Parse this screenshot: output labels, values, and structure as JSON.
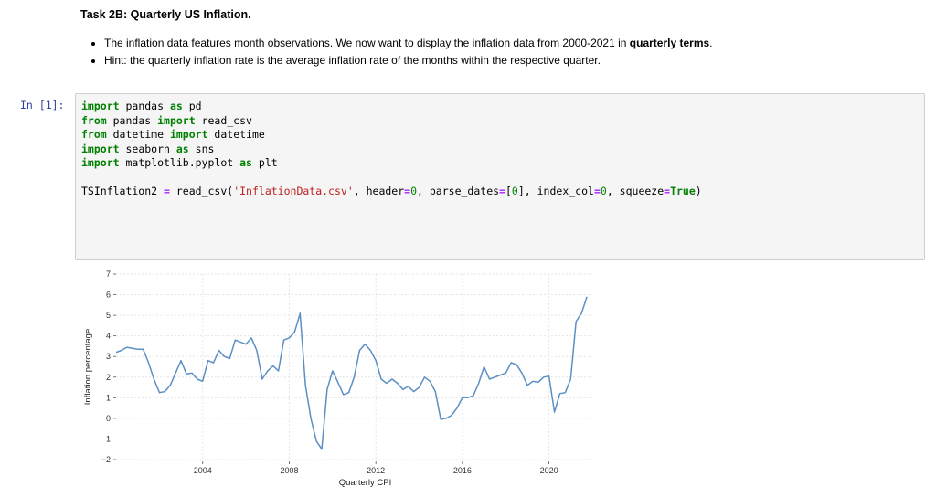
{
  "markdown": {
    "heading": "Task 2B: Quarterly US Inflation.",
    "bullet1_text": "The inflation data features month observations. We now want to display the inflation data from 2000-2021 in ",
    "bullet1_link": "quarterly terms",
    "bullet1_end": ".",
    "bullet2": "Hint: the quarterly inflation rate is the average inflation rate of the months within the respective quarter."
  },
  "cell": {
    "prompt": "In [1]:",
    "code": {
      "l1": {
        "kw1": "import",
        "t1": " pandas ",
        "kw2": "as",
        "t2": " pd"
      },
      "l2": {
        "kw1": "from",
        "t1": " pandas ",
        "kw2": "import",
        "t2": " read_csv"
      },
      "l3": {
        "kw1": "from",
        "t1": " datetime ",
        "kw2": "import",
        "t2": " datetime"
      },
      "l4": {
        "kw1": "import",
        "t1": " seaborn ",
        "kw2": "as",
        "t2": " sns"
      },
      "l5": {
        "kw1": "import",
        "t1": " matplotlib.pyplot ",
        "kw2": "as",
        "t2": " plt"
      },
      "l7": {
        "t1": "TSInflation2 ",
        "op1": "=",
        "t2": " read_csv(",
        "s1": "'InflationData.csv'",
        "t3": ", header",
        "op2": "=",
        "n1": "0",
        "t4": ", parse_dates",
        "op3": "=",
        "t5": "[",
        "n2": "0",
        "t6": "], index_col",
        "op4": "=",
        "n3": "0",
        "t7": ", squeeze",
        "op5": "=",
        "kw1": "True",
        "t8": ")"
      }
    }
  },
  "colors": {
    "line": "#5b8fc4",
    "keyword": "#008000",
    "string": "#ba2121",
    "operator": "#aa22ff",
    "prompt": "#303f9f"
  },
  "chart_data": {
    "type": "line",
    "title": "",
    "xlabel": "Quarterly CPI",
    "ylabel": "Inflation percentage",
    "xlim": [
      2000,
      2022
    ],
    "ylim": [
      -2,
      7
    ],
    "xticks": [
      2004,
      2008,
      2012,
      2016,
      2020
    ],
    "yticks": [
      7,
      6,
      5,
      4,
      3,
      2,
      1,
      0,
      -1,
      -2
    ],
    "ytick_labels": [
      "7",
      "6",
      "5",
      "4",
      "3",
      "2",
      "1",
      "0",
      "−1",
      "−2"
    ],
    "grid": true,
    "series": [
      {
        "x": [
          2000.0,
          2000.25,
          2000.5,
          2000.75,
          2001.0,
          2001.25,
          2001.5,
          2001.75,
          2002.0,
          2002.25,
          2002.5,
          2002.75,
          2003.0,
          2003.25,
          2003.5,
          2003.75,
          2004.0,
          2004.25,
          2004.5,
          2004.75,
          2005.0,
          2005.25,
          2005.5,
          2005.75,
          2006.0,
          2006.25,
          2006.5,
          2006.75,
          2007.0,
          2007.25,
          2007.5,
          2007.75,
          2008.0,
          2008.25,
          2008.5,
          2008.75,
          2009.0,
          2009.25,
          2009.5,
          2009.75,
          2010.0,
          2010.25,
          2010.5,
          2010.75,
          2011.0,
          2011.25,
          2011.5,
          2011.75,
          2012.0,
          2012.25,
          2012.5,
          2012.75,
          2013.0,
          2013.25,
          2013.5,
          2013.75,
          2014.0,
          2014.25,
          2014.5,
          2014.75,
          2015.0,
          2015.25,
          2015.5,
          2015.75,
          2016.0,
          2016.25,
          2016.5,
          2016.75,
          2017.0,
          2017.25,
          2017.5,
          2017.75,
          2018.0,
          2018.25,
          2018.5,
          2018.75,
          2019.0,
          2019.25,
          2019.5,
          2019.75,
          2020.0,
          2020.25,
          2020.5,
          2020.75,
          2021.0,
          2021.25,
          2021.5,
          2021.75
        ],
        "y": [
          3.2,
          3.3,
          3.45,
          3.4,
          3.35,
          3.35,
          2.7,
          1.9,
          1.25,
          1.3,
          1.6,
          2.2,
          2.8,
          2.15,
          2.2,
          1.9,
          1.8,
          2.8,
          2.7,
          3.3,
          3.0,
          2.9,
          3.8,
          3.7,
          3.6,
          3.9,
          3.3,
          1.9,
          2.3,
          2.55,
          2.3,
          3.8,
          3.9,
          4.2,
          5.1,
          1.6,
          0.0,
          -1.1,
          -1.5,
          1.4,
          2.3,
          1.75,
          1.15,
          1.25,
          2.0,
          3.3,
          3.6,
          3.3,
          2.8,
          1.9,
          1.7,
          1.9,
          1.7,
          1.4,
          1.55,
          1.3,
          1.5,
          2.0,
          1.8,
          1.3,
          -0.05,
          0.0,
          0.15,
          0.5,
          1.0,
          1.0,
          1.1,
          1.7,
          2.5,
          1.9,
          2.0,
          2.1,
          2.2,
          2.7,
          2.6,
          2.2,
          1.6,
          1.8,
          1.75,
          2.0,
          2.05,
          0.3,
          1.2,
          1.25,
          1.9,
          4.7,
          5.1,
          5.9
        ]
      }
    ]
  }
}
